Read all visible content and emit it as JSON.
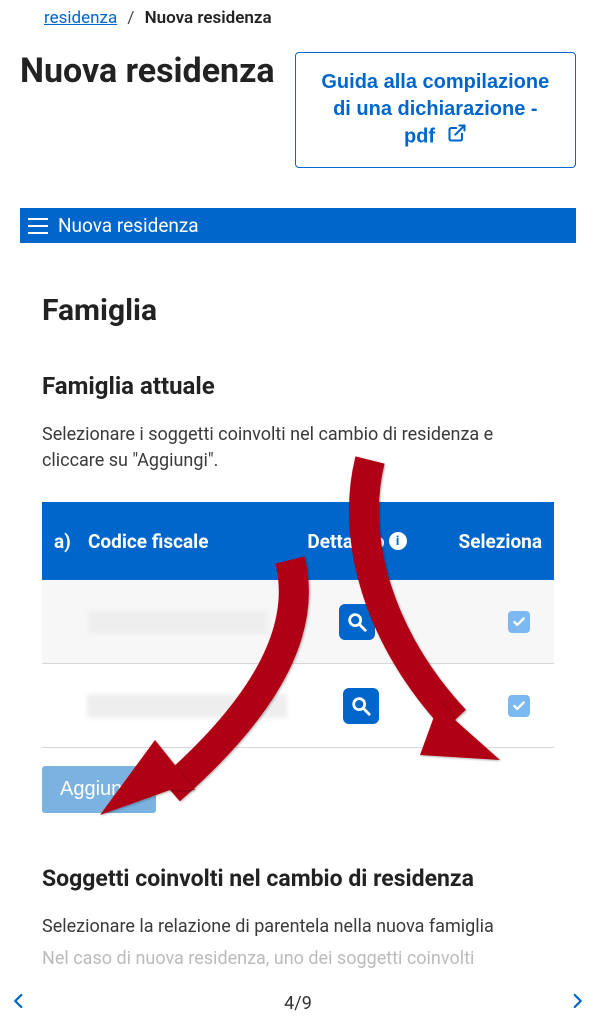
{
  "breadcrumb": {
    "link": "residenza",
    "current": "Nuova residenza"
  },
  "page_title": "Nuova residenza",
  "guide_button": "Guida alla compilazione di una dichiarazione - pdf",
  "section_bar": "Nuova residenza",
  "family": {
    "heading": "Famiglia",
    "current_heading": "Famiglia attuale",
    "instruction": "Selezionare i soggetti coinvolti nel cambio di residenza e cliccare su \"Aggiungi\".",
    "table": {
      "col_a": "a)",
      "col_fiscale": "Codice fiscale",
      "col_dettaglio": "Dettaglio",
      "col_seleziona": "Seleziona"
    },
    "add_button": "Aggiungi",
    "subjects_heading": "Soggetti coinvolti nel cambio di residenza",
    "subjects_text": "Selezionare la relazione di parentela nella nuova famiglia",
    "subjects_text2": "Nel caso di nuova residenza, uno dei soggetti coinvolti"
  },
  "pager": "4/9"
}
